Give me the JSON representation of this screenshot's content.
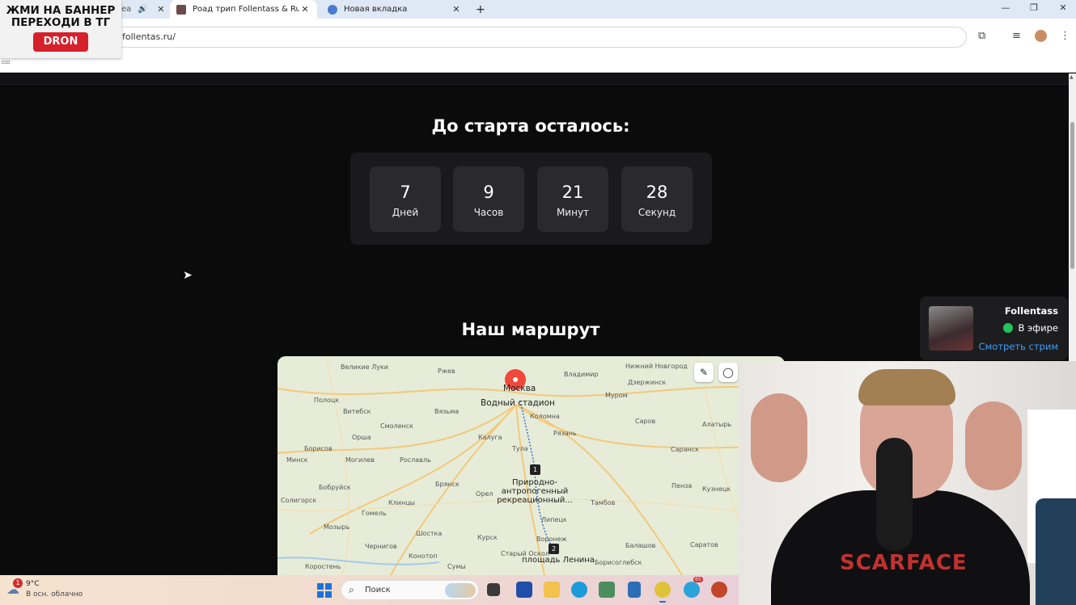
{
  "browser": {
    "tabs": [
      {
        "title": "еа",
        "favicon": "speaker-icon"
      },
      {
        "title": "Роад трип Follentass & RudySa",
        "active": true
      },
      {
        "title": "Новая вкладка"
      }
    ],
    "new_tab_label": "+",
    "address": "follentas.ru/",
    "window_controls": {
      "minimize": "—",
      "restore": "❐",
      "close": "✕"
    }
  },
  "ad_banner": {
    "line1": "ЖМИ НА БАННЕР",
    "line2": "ПЕРЕХОДИ В ТГ",
    "button": "DRON"
  },
  "countdown": {
    "heading": "До старта осталось:",
    "units": [
      {
        "value": "7",
        "label": "Дней"
      },
      {
        "value": "9",
        "label": "Часов"
      },
      {
        "value": "21",
        "label": "Минут"
      },
      {
        "value": "28",
        "label": "Секунд"
      }
    ]
  },
  "route": {
    "heading": "Наш маршрут",
    "map": {
      "destination_label": "Москва",
      "destination_sub": "Водный стадион",
      "waypoints": [
        {
          "num": "1",
          "label": "Природно-\nантропогенный\nрекреационный..."
        },
        {
          "num": "2",
          "label": "площадь Ленина"
        }
      ],
      "cities": [
        "Великие Луки",
        "Ржев",
        "Владимир",
        "Нижний Новгород",
        "Полоцк",
        "Витебск",
        "Вязьма",
        "Муром",
        "Дзержинск",
        "Смоленск",
        "Коломна",
        "Орша",
        "Калуга",
        "Рязань",
        "Саров",
        "Алатырь",
        "Борисов",
        "Минск",
        "Могилев",
        "Рославль",
        "Тула",
        "Саранск",
        "Бобруйск",
        "Брянск",
        "Пенза",
        "Орел",
        "Кузнецк",
        "Солигорск",
        "Гомель",
        "Клинцы",
        "Липецк",
        "Тамбов",
        "Мозырь",
        "Шостка",
        "Курск",
        "Воронеж",
        "Балашов",
        "Чернигов",
        "Конотоп",
        "Старый Оскол",
        "Саратов",
        "Сумы",
        "Коростень",
        "Борисоглебск"
      ]
    }
  },
  "stream_notification": {
    "name": "Follentass",
    "status": "В эфире",
    "watch_link": "Смотреть стрим"
  },
  "webcam": {
    "shirt_print": "SCARFACE"
  },
  "taskbar": {
    "weather_badge": "1",
    "temperature": "9°C",
    "weather_desc": "В осн. облачно",
    "search_placeholder": "Поиск",
    "telegram_badge": "65"
  },
  "colors": {
    "page_bg": "#0b0b0c",
    "panel_bg": "#1a1a1c",
    "box_bg": "#2a2a2d",
    "map_pin": "#f0483a",
    "live_dot": "#21c55d",
    "link": "#3aa0ff",
    "ad_button": "#d6202a"
  }
}
